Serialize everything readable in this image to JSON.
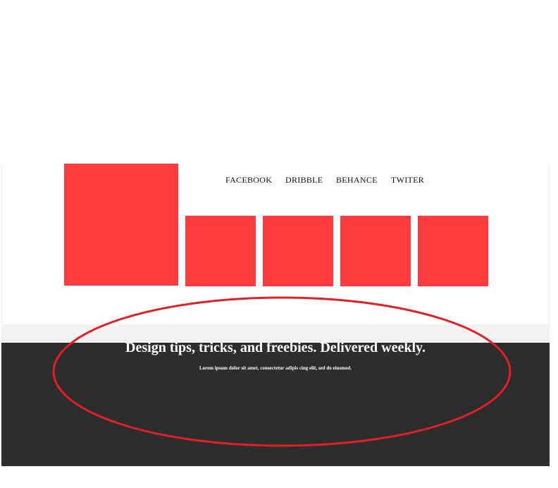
{
  "header": {
    "social_links": [
      {
        "label": "FACEBOOK"
      },
      {
        "label": "DRIBBLE"
      },
      {
        "label": "BEHANCE"
      },
      {
        "label": "TWITER"
      }
    ]
  },
  "newsletter": {
    "title": "Design tips, tricks, and freebies. Delivered weekly.",
    "subtitle": "Lorem ipsum dolor sit amet, consectetur adipis cing elit, sed do eiusmod."
  },
  "colors": {
    "accent": "#fd3c40",
    "dark_section": "#2e2d2d",
    "light_band": "#f4f1f1",
    "annotation_ellipse": "#e02027"
  }
}
